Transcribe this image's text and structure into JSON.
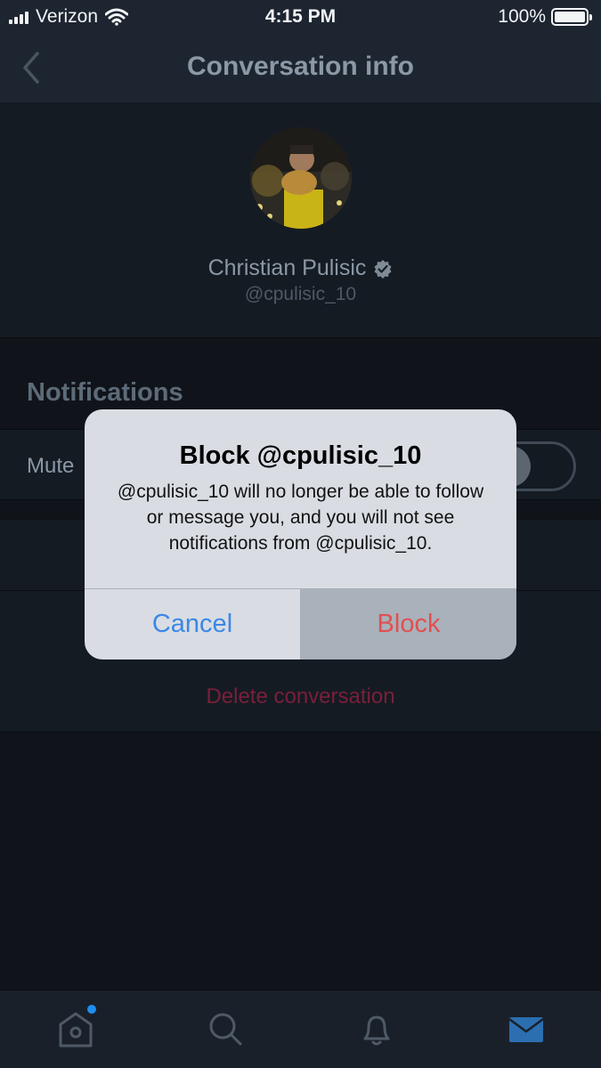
{
  "status_bar": {
    "carrier": "Verizon",
    "time": "4:15 PM",
    "battery_percent": "100%",
    "battery_level": 1.0,
    "signal_bars": 4,
    "icons": [
      "signal-icon",
      "wifi-icon",
      "battery-icon"
    ]
  },
  "nav": {
    "title": "Conversation info",
    "back_icon": "chevron-left-icon"
  },
  "profile": {
    "name": "Christian Pulisic",
    "handle": "@cpulisic_10",
    "verified": true,
    "badge_icon": "verified-badge-icon"
  },
  "notifications": {
    "header": "Notifications",
    "mute_label": "Mute",
    "mute_enabled": false
  },
  "actions": {
    "delete_label": "Delete conversation"
  },
  "alert": {
    "title": "Block @cpulisic_10",
    "message": "@cpulisic_10 will no longer be able to follow or message you, and you will not see notifications from @cpulisic_10.",
    "cancel_label": "Cancel",
    "block_label": "Block"
  },
  "tab_bar": {
    "tabs": [
      {
        "name": "home",
        "icon": "home-icon",
        "has_badge": true
      },
      {
        "name": "search",
        "icon": "search-icon",
        "has_badge": false
      },
      {
        "name": "notifications",
        "icon": "bell-icon",
        "has_badge": false
      },
      {
        "name": "messages",
        "icon": "envelope-icon",
        "active": true
      }
    ]
  },
  "colors": {
    "accent": "#1d8ef0",
    "destructive": "#e0504f",
    "cancel": "#3b87e6",
    "background": "#10141a"
  }
}
